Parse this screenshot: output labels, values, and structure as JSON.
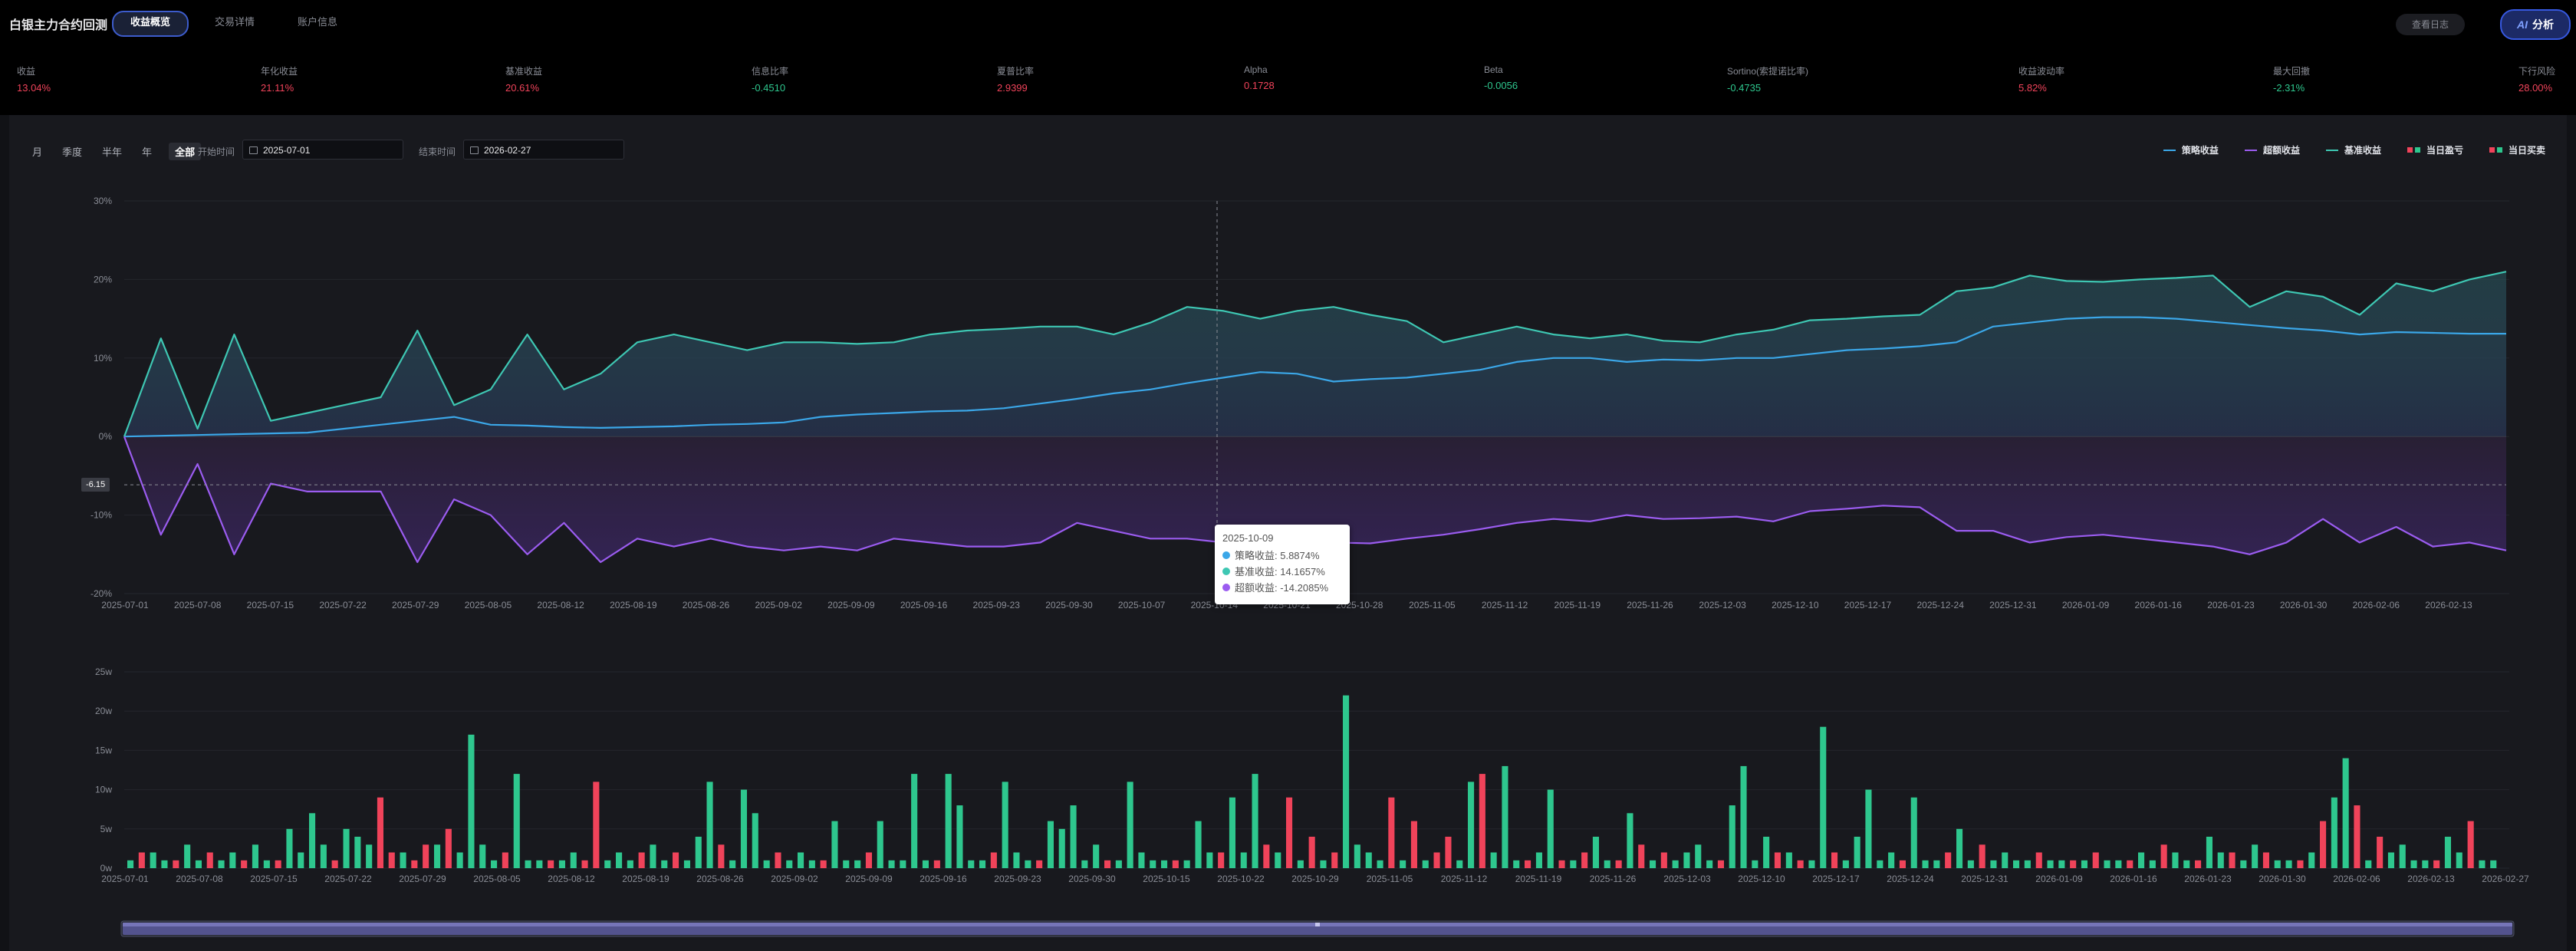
{
  "header": {
    "title": "白银主力合约回测",
    "tabs": [
      {
        "label": "收益概览",
        "active": true
      },
      {
        "label": "交易详情",
        "active": false
      },
      {
        "label": "账户信息",
        "active": false
      }
    ],
    "log_button": "查看日志",
    "ai_button": {
      "mark": "AI",
      "label": "分析"
    }
  },
  "metrics": [
    {
      "label": "收益",
      "value": "13.04%",
      "tone": "red"
    },
    {
      "label": "年化收益",
      "value": "21.11%",
      "tone": "red"
    },
    {
      "label": "基准收益",
      "value": "20.61%",
      "tone": "red"
    },
    {
      "label": "信息比率",
      "value": "-0.4510",
      "tone": "green"
    },
    {
      "label": "夏普比率",
      "value": "2.9399",
      "tone": "red"
    },
    {
      "label": "Alpha",
      "value": "0.1728",
      "tone": "red"
    },
    {
      "label": "Beta",
      "value": "-0.0056",
      "tone": "green"
    },
    {
      "label": "Sortino(索提诺比率)",
      "value": "-0.4735",
      "tone": "green"
    },
    {
      "label": "收益波动率",
      "value": "5.82%",
      "tone": "red"
    },
    {
      "label": "最大回撤",
      "value": "-2.31%",
      "tone": "green"
    },
    {
      "label": "下行风险",
      "value": "28.00%",
      "tone": "red"
    }
  ],
  "controls": {
    "periods": [
      {
        "label": "月",
        "active": false
      },
      {
        "label": "季度",
        "active": false
      },
      {
        "label": "半年",
        "active": false
      },
      {
        "label": "年",
        "active": false
      },
      {
        "label": "全部",
        "active": true
      }
    ],
    "start_label": "开始时间",
    "start_value": "2025-07-01",
    "end_label": "结束时间",
    "end_value": "2026-02-27"
  },
  "legend": [
    {
      "label": "策略收益",
      "kind": "line",
      "color": "#3ba7e8"
    },
    {
      "label": "超额收益",
      "kind": "line",
      "color": "#9b5cf0"
    },
    {
      "label": "基准收益",
      "kind": "line",
      "color": "#3ec7b3"
    },
    {
      "label": "当日盈亏",
      "kind": "bars",
      "colors": [
        "#f0435a",
        "#2ec78e"
      ]
    },
    {
      "label": "当日买卖",
      "kind": "bars",
      "colors": [
        "#f0435a",
        "#2ec78e"
      ]
    }
  ],
  "tooltip": {
    "date": "2025-10-09",
    "rows": [
      {
        "label": "策略收益: 5.8874%",
        "color": "#3ba7e8"
      },
      {
        "label": "基准收益: 14.1657%",
        "color": "#3ec7b3"
      },
      {
        "label": "超额收益: -14.2085%",
        "color": "#9b5cf0"
      }
    ]
  },
  "crosshair_value": "-6.15",
  "chart_data": [
    {
      "type": "line",
      "ylim": [
        -20,
        30
      ],
      "yticks": [
        "30%",
        "20%",
        "10%",
        "0%",
        "-10%",
        "-20%"
      ],
      "ytick_values": [
        30,
        20,
        10,
        0,
        -10,
        -20
      ],
      "xticks": [
        "2025-07-01",
        "2025-07-08",
        "2025-07-15",
        "2025-07-22",
        "2025-07-29",
        "2025-08-05",
        "2025-08-12",
        "2025-08-19",
        "2025-08-26",
        "2025-09-02",
        "2025-09-09",
        "2025-09-16",
        "2025-09-23",
        "2025-09-30",
        "2025-10-07",
        "2025-10-14",
        "2025-10-21",
        "2025-10-28",
        "2025-11-05",
        "2025-11-12",
        "2025-11-19",
        "2025-11-26",
        "2025-12-03",
        "2025-12-10",
        "2025-12-17",
        "2025-12-24",
        "2025-12-31",
        "2026-01-09",
        "2026-01-16",
        "2026-01-23",
        "2026-01-30",
        "2026-02-06",
        "2026-02-13"
      ],
      "series": [
        {
          "name": "策略收益",
          "color": "#3ba7e8",
          "values": [
            0,
            0.1,
            0.2,
            0.3,
            0.4,
            0.5,
            1,
            1.5,
            2,
            2.5,
            1.5,
            1.4,
            1.2,
            1.1,
            1.2,
            1.3,
            1.5,
            1.6,
            1.8,
            2.5,
            2.8,
            3,
            3.2,
            3.3,
            3.6,
            4.2,
            4.8,
            5.5,
            6,
            6.8,
            7.5,
            8.2,
            8,
            7,
            7.3,
            7.5,
            8,
            8.5,
            9.5,
            10,
            10,
            9.5,
            9.8,
            9.7,
            10,
            10,
            10.5,
            11,
            11.2,
            11.5,
            12,
            14,
            14.5,
            15,
            15.2,
            15.2,
            15,
            14.6,
            14.2,
            13.8,
            13.5,
            13,
            13.3,
            13.2,
            13.1,
            13.1
          ]
        },
        {
          "name": "基准收益",
          "color": "#3ec7b3",
          "values": [
            0,
            12.5,
            1,
            13,
            2,
            3,
            4,
            5,
            13.5,
            4,
            6,
            13,
            6,
            8,
            12,
            13,
            12,
            11,
            12,
            12,
            11.8,
            12,
            13,
            13.5,
            13.7,
            14,
            14,
            13,
            14.5,
            16.5,
            16,
            15,
            16,
            16.5,
            15.5,
            14.7,
            12,
            13,
            14,
            13,
            12.5,
            13,
            12.2,
            12,
            13,
            13.6,
            14.8,
            15,
            15.3,
            15.5,
            18.5,
            19,
            20.5,
            19.8,
            19.7,
            20,
            20.2,
            20.5,
            16.5,
            18.5,
            17.8,
            15.5,
            19.5,
            18.5,
            20,
            21
          ]
        },
        {
          "name": "超额收益",
          "color": "#9b5cf0",
          "values": [
            0,
            -12.5,
            -3.5,
            -15,
            -6,
            -7,
            -7,
            -7,
            -16,
            -8,
            -10,
            -15,
            -11,
            -16,
            -13,
            -14,
            -13,
            -14,
            -14.5,
            -14,
            -14.5,
            -13,
            -13.5,
            -14,
            -14,
            -13.5,
            -11,
            -12,
            -13,
            -13,
            -13.5,
            -13.2,
            -13,
            -13.5,
            -13.6,
            -13,
            -12.5,
            -11.8,
            -11,
            -10.5,
            -10.8,
            -10,
            -10.5,
            -10.4,
            -10.2,
            -10.8,
            -9.5,
            -9.2,
            -8.8,
            -9,
            -12,
            -12,
            -13.5,
            -12.8,
            -12.5,
            -13,
            -13.5,
            -14,
            -15,
            -13.5,
            -10.5,
            -13.5,
            -11.5,
            -14,
            -13.5,
            -14.5
          ]
        }
      ]
    },
    {
      "type": "bar",
      "ylim": [
        0,
        25
      ],
      "yticks": [
        "25w",
        "20w",
        "15w",
        "10w",
        "5w",
        "0w"
      ],
      "ytick_values": [
        25,
        20,
        15,
        10,
        5,
        0
      ],
      "xticks": [
        "2025-07-01",
        "2025-07-08",
        "2025-07-15",
        "2025-07-22",
        "2025-07-29",
        "2025-08-05",
        "2025-08-12",
        "2025-08-19",
        "2025-08-26",
        "2025-09-02",
        "2025-09-09",
        "2025-09-16",
        "2025-09-23",
        "2025-09-30",
        "2025-10-15",
        "2025-10-22",
        "2025-10-29",
        "2025-11-05",
        "2025-11-12",
        "2025-11-19",
        "2025-11-26",
        "2025-12-03",
        "2025-12-10",
        "2025-12-17",
        "2025-12-24",
        "2025-12-31",
        "2026-01-09",
        "2026-01-16",
        "2026-01-23",
        "2026-01-30",
        "2026-02-06",
        "2026-02-13",
        "2026-02-27"
      ],
      "series": [
        {
          "name": "当日盈亏",
          "values": [
            1,
            -2,
            2,
            1,
            -1,
            3,
            1,
            -2,
            1,
            2,
            -1,
            3,
            1,
            -1,
            5,
            2,
            7,
            3,
            -1,
            5,
            4,
            3,
            -9,
            -2,
            2,
            -1,
            -3,
            3,
            -5,
            2,
            17,
            3,
            1,
            -2,
            12,
            1,
            1,
            -1,
            1,
            2,
            -1,
            -11,
            1,
            2,
            1,
            -2,
            3,
            1,
            -2,
            1,
            4,
            11,
            -3,
            1,
            10,
            7,
            1,
            -2,
            1,
            2,
            1,
            -1,
            6,
            1,
            1,
            -2,
            6,
            1,
            1,
            12,
            1,
            -1,
            12,
            8,
            1,
            1,
            -2,
            11,
            2,
            1,
            -1,
            6,
            5,
            8,
            1,
            3,
            -1,
            1,
            11,
            2,
            1,
            1,
            -1,
            1,
            6,
            2,
            -2,
            9,
            2,
            12,
            -3,
            2,
            -9,
            1,
            -4,
            1,
            -2,
            22,
            3,
            2,
            1,
            -9,
            1,
            -6,
            1,
            -2,
            -4,
            1,
            11,
            -12,
            2,
            13,
            1,
            -1,
            2,
            10,
            -1,
            1,
            -2,
            4,
            1,
            -1,
            7,
            -3,
            1,
            -2,
            1,
            2,
            3,
            1,
            -1,
            8,
            13,
            1,
            4,
            -2,
            2,
            -1,
            1,
            18,
            -2,
            1,
            4,
            10,
            1,
            2,
            -1,
            9,
            1,
            1,
            -2,
            5,
            1,
            -3,
            1,
            2,
            1,
            1,
            -2,
            1,
            1,
            -1,
            1,
            -2,
            1,
            1,
            -1,
            2,
            1,
            -3,
            2,
            1,
            -1,
            4,
            2,
            -2,
            1,
            3,
            -2,
            1,
            1,
            -1,
            2,
            -6,
            9,
            14,
            -8,
            1,
            -4,
            2,
            3,
            1,
            1,
            -1,
            4,
            2,
            -6,
            1,
            1
          ]
        }
      ]
    }
  ]
}
